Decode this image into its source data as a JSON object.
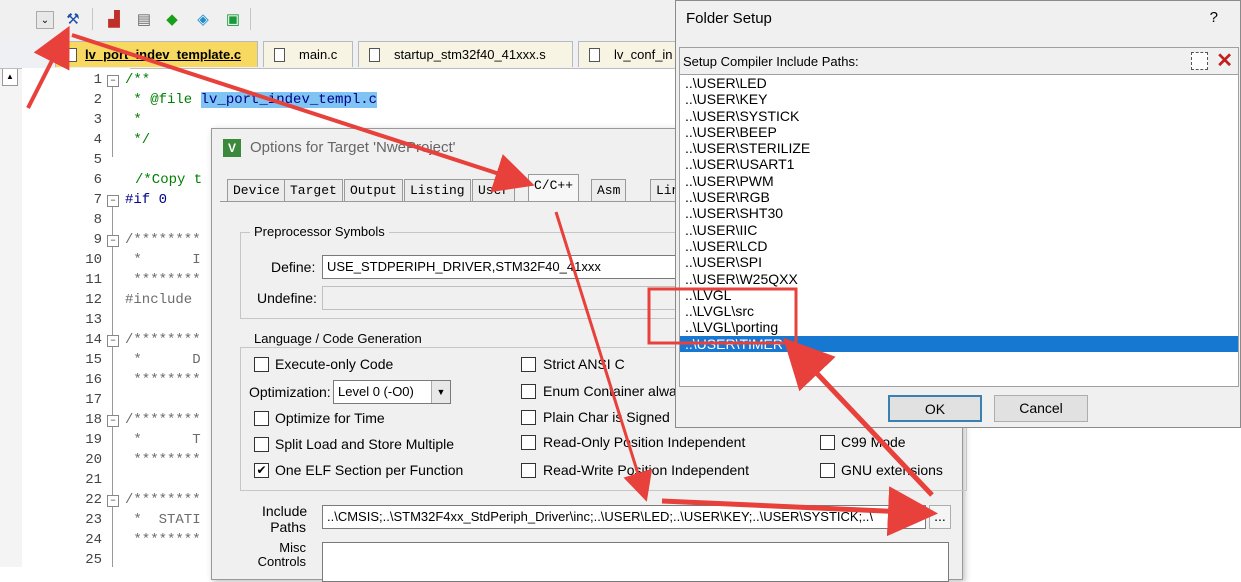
{
  "toolbar": {
    "icons": [
      "dropdown-icon",
      "options-for-target-icon",
      "manage-components-icon",
      "project-items-icon",
      "run-icon",
      "pack-installer-icon",
      "select-packs-icon"
    ]
  },
  "file_tabs": [
    {
      "label": "lv_port_indev_template.c",
      "active": true
    },
    {
      "label": "main.c",
      "active": false
    },
    {
      "label": "startup_stm32f40_41xxx.s",
      "active": false
    },
    {
      "label": "lv_conf_in",
      "active": false
    }
  ],
  "editor": {
    "line_numbers": [
      "1",
      "2",
      "3",
      "4",
      "5",
      "6",
      "7",
      "8",
      "9",
      "10",
      "11",
      "12",
      "13",
      "14",
      "15",
      "16",
      "17",
      "18",
      "19",
      "20",
      "21",
      "22",
      "23",
      "24",
      "25"
    ],
    "lines": {
      "l1": "/**",
      "l2_prefix": " * @file ",
      "l2_selected": "lv_port_indev_templ.c",
      "l3": " *",
      "l4": " */",
      "l6": "/*Copy t",
      "l7_kw": "#if",
      "l7_rest": " 0",
      "l9": "/********",
      "l10": " *      I",
      "l11": " ********",
      "l12": "#include",
      "l14": "/********",
      "l15": " *      D",
      "l16": " ********",
      "l18": "/********",
      "l19": " *      T",
      "l20": " ********",
      "l22": "/********",
      "l23": " *  STATI",
      "l24": " ********"
    }
  },
  "options_dialog": {
    "title": "Options for Target 'NweProject'",
    "tabs": [
      "Device",
      "Target",
      "Output",
      "Listing",
      "User",
      "C/C++",
      "Asm",
      "Lin"
    ],
    "active_tab": "C/C++",
    "preprocessor": {
      "group_label": "Preprocessor Symbols",
      "define_label": "Define:",
      "define_value": "USE_STDPERIPH_DRIVER,STM32F40_41xxx",
      "undefine_label": "Undefine:",
      "undefine_value": ""
    },
    "language": {
      "group_label": "Language / Code Generation",
      "execute_only": {
        "label": "Execute-only Code",
        "checked": false
      },
      "optimization_label": "Optimization:",
      "optimization_value": "Level 0 (-O0)",
      "optimize_time": {
        "label": "Optimize for Time",
        "checked": false
      },
      "split_load": {
        "label": "Split Load and Store Multiple",
        "checked": false
      },
      "one_elf": {
        "label": "One ELF Section per Function",
        "checked": true
      },
      "strict_ansi": {
        "label": "Strict ANSI C",
        "checked": false
      },
      "enum_container": {
        "label": "Enum Container always",
        "checked": false
      },
      "plain_char": {
        "label": "Plain Char is Signed",
        "checked": false
      },
      "ro_pos": {
        "label": "Read-Only Position Independent",
        "checked": false
      },
      "rw_pos": {
        "label": "Read-Write Position Independent",
        "checked": false
      },
      "c99": {
        "label": "C99 Mode",
        "checked": false
      },
      "gnu_ext": {
        "label": "GNU extensions",
        "checked": false
      }
    },
    "include_label_1": "Include",
    "include_label_2": "Paths",
    "include_value": "..\\CMSIS;..\\STM32F4xx_StdPeriph_Driver\\inc;..\\USER\\LED;..\\USER\\KEY;..\\USER\\SYSTICK;..\\",
    "browse_label": "...",
    "misc_label_1": "Misc",
    "misc_label_2": "Controls"
  },
  "folder_setup": {
    "title": "Folder Setup",
    "help": "?",
    "header": "Setup Compiler Include Paths:",
    "paths": [
      "..\\USER\\LED",
      "..\\USER\\KEY",
      "..\\USER\\SYSTICK",
      "..\\USER\\BEEP",
      "..\\USER\\STERILIZE",
      "..\\USER\\USART1",
      "..\\USER\\PWM",
      "..\\USER\\RGB",
      "..\\USER\\SHT30",
      "..\\USER\\IIC",
      "..\\USER\\LCD",
      "..\\USER\\SPI",
      "..\\USER\\W25QXX",
      "..\\LVGL",
      "..\\LVGL\\src",
      "..\\LVGL\\porting",
      "..\\USER\\TIMER"
    ],
    "selected_path": "..\\USER\\TIMER",
    "ok_label": "OK",
    "cancel_label": "Cancel"
  },
  "annotation_color": "#e8403a"
}
